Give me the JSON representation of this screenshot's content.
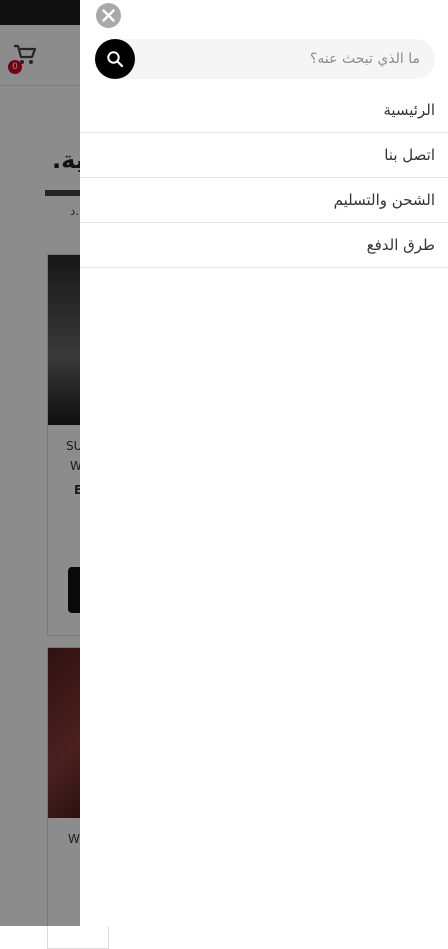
{
  "header": {
    "cart_count": "0"
  },
  "background": {
    "title": "ية.",
    "subtitle": "د.",
    "product1": {
      "line1": "SU",
      "line2": "W",
      "line3": "E"
    },
    "product2": {
      "line1": "W"
    }
  },
  "search": {
    "placeholder": "ما الذي تبحث عنه؟"
  },
  "menu": {
    "items": [
      {
        "label": "الرئيسية"
      },
      {
        "label": "اتصل بنا"
      },
      {
        "label": "الشحن والتسليم"
      },
      {
        "label": "طرق الدفع"
      }
    ]
  },
  "icons": {
    "close": "close-icon",
    "search": "search-icon",
    "cart": "cart-icon"
  },
  "colors": {
    "overlay": "#000000",
    "badge": "#d0021b",
    "search_button": "#000000"
  }
}
